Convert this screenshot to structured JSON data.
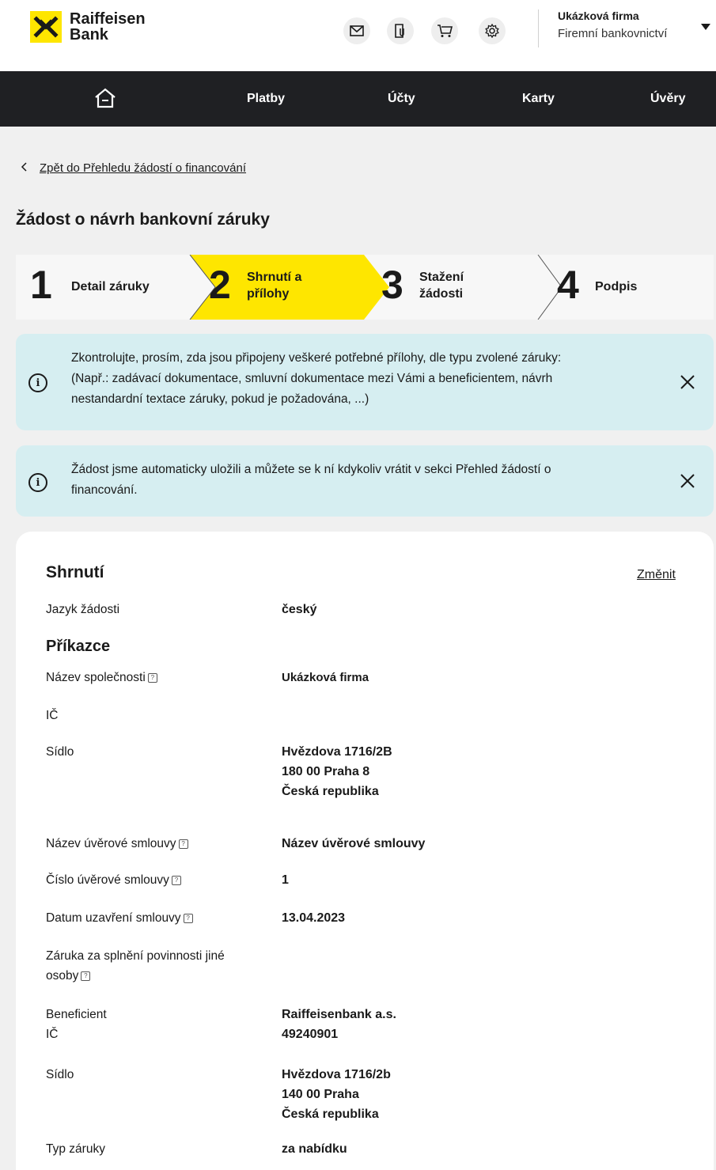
{
  "header": {
    "logo_line1": "Raiffeisen",
    "logo_line2": "Bank",
    "account_name": "Ukázková firma",
    "account_type": "Firemní bankovnictví",
    "icons": [
      "mail-icon",
      "document-clip-icon",
      "cart-icon",
      "gear-icon"
    ]
  },
  "nav": {
    "home_icon": "home-icon",
    "items": [
      "Platby",
      "Účty",
      "Karty",
      "Úvěry"
    ]
  },
  "back_link": "Zpět do Přehledu žádostí o financování",
  "page_title": "Žádost o návrh bankovní záruky",
  "stepper": {
    "active_color": "#fee600",
    "steps": [
      {
        "number": "1",
        "line1": "Detail záruky",
        "line2": ""
      },
      {
        "number": "2",
        "line1": "Shrnutí a",
        "line2": "přílohy"
      },
      {
        "number": "3",
        "line1": "Stažení",
        "line2": "žádosti"
      },
      {
        "number": "4",
        "line1": "Podpis",
        "line2": ""
      }
    ]
  },
  "alerts": [
    {
      "lines": [
        "Zkontrolujte, prosím, zda jsou připojeny veškeré potřebné přílohy, dle typu zvolené záruky:",
        "(Např.: zadávací dokumentace, smluvní dokumentace mezi Vámi a beneficientem, návrh",
        "nestandardní textace záruky, pokud je požadována, ...)"
      ]
    },
    {
      "lines": [
        "Žádost jsme automaticky uložili a můžete se k ní kdykoliv vrátit v sekci  Přehled žádostí o",
        "financování."
      ]
    }
  ],
  "summary": {
    "title": "Shrnutí",
    "change_label": "Změnit",
    "language_label": "Jazyk žádosti",
    "language_value": "český",
    "principal_heading": "Příkazce",
    "company_label": "Název společnosti",
    "company_value": "Ukázková firma",
    "ico_label": "IČ",
    "seat_label": "Sídlo",
    "seat_lines": [
      "Hvězdova  1716/2B",
      "180 00  Praha 8",
      "Česká republika"
    ],
    "contract_name_label": "Název úvěrové smlouvy",
    "contract_name_value": "Název úvěrové smlouvy",
    "contract_number_label": "Číslo úvěrové smlouvy",
    "contract_number_value": "1",
    "contract_date_label": "Datum uzavření smlouvy",
    "contract_date_value": "13.04.2023",
    "third_party_label_line1": "Záruka za splnění povinnosti jiné",
    "third_party_label_line2": "osoby",
    "beneficiary_label": "Beneficient",
    "beneficiary_value": "Raiffeisenbank a.s.",
    "beneficiary_ico_label": "IČ",
    "beneficiary_ico_value": "49240901",
    "beneficiary_seat_label": "Sídlo",
    "beneficiary_seat_lines": [
      "Hvězdova  1716/2b",
      "140 00  Praha",
      "Česká republika"
    ],
    "guarantee_type_label": "Typ záruky",
    "guarantee_type_value": "za nabídku"
  }
}
